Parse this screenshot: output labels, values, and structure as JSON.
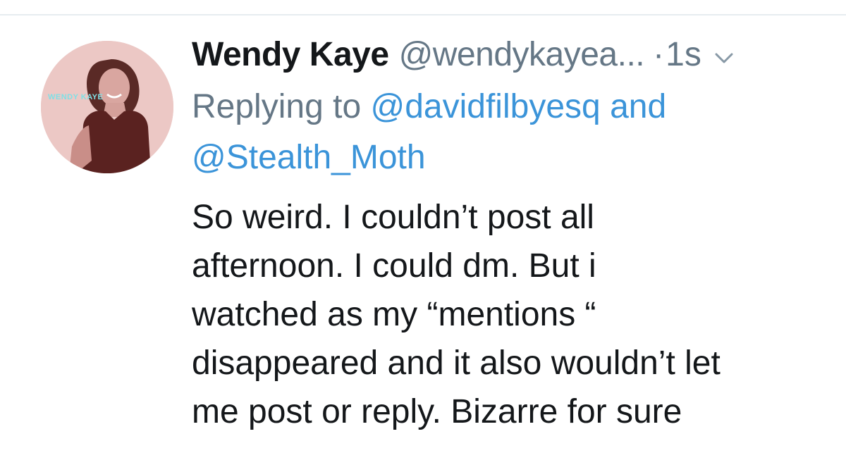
{
  "tweet": {
    "author": {
      "display_name": "Wendy Kaye",
      "handle": "@wendykayea...",
      "avatar_text": "WENDY KAYE"
    },
    "separator": "·",
    "time": "1s",
    "reply": {
      "prefix": "Replying to",
      "mention_1": "@davidfilbyesq",
      "conjunction": "and",
      "mention_2": "@Stealth_Moth"
    },
    "text_lines": [
      "So weird. I couldn’t post all",
      "afternoon. I could dm. But i",
      "watched as my “mentions “",
      "disappeared and it also wouldn’t let",
      "me post or reply. Bizarre for sure"
    ]
  },
  "colors": {
    "text": "#14171a",
    "secondary": "#657786",
    "link": "#3b94d9",
    "divider": "#e6ecf0"
  },
  "icons": {
    "caret": "chevron-down-icon",
    "reply": "reply-icon",
    "retweet": "retweet-icon",
    "like": "heart-icon"
  }
}
